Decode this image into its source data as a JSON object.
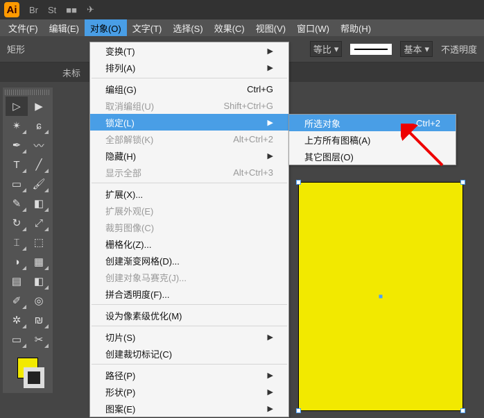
{
  "titlebar": {
    "logo": "Ai",
    "icons": [
      "Br",
      "St",
      "■■",
      "✈"
    ]
  },
  "menubar": {
    "items": [
      {
        "label": "文件(F)"
      },
      {
        "label": "编辑(E)"
      },
      {
        "label": "对象(O)",
        "open": true
      },
      {
        "label": "文字(T)"
      },
      {
        "label": "选择(S)"
      },
      {
        "label": "效果(C)"
      },
      {
        "label": "视图(V)"
      },
      {
        "label": "窗口(W)"
      },
      {
        "label": "帮助(H)"
      }
    ]
  },
  "optionsbar": {
    "shape": "矩形",
    "scale_label": "等比",
    "basic_label": "基本",
    "opacity_label": "不透明度"
  },
  "doctabs": {
    "tab1": "未标"
  },
  "object_menu": {
    "items": [
      {
        "label": "变换(T)",
        "arrow": true
      },
      {
        "label": "排列(A)",
        "arrow": true
      },
      {
        "sep": true
      },
      {
        "label": "编组(G)",
        "shortcut": "Ctrl+G"
      },
      {
        "label": "取消编组(U)",
        "shortcut": "Shift+Ctrl+G",
        "disabled": true
      },
      {
        "label": "锁定(L)",
        "arrow": true,
        "highlight": true
      },
      {
        "label": "全部解锁(K)",
        "shortcut": "Alt+Ctrl+2",
        "disabled": true
      },
      {
        "label": "隐藏(H)",
        "arrow": true
      },
      {
        "label": "显示全部",
        "shortcut": "Alt+Ctrl+3",
        "disabled": true
      },
      {
        "sep": true
      },
      {
        "label": "扩展(X)..."
      },
      {
        "label": "扩展外观(E)",
        "disabled": true
      },
      {
        "label": "裁剪图像(C)",
        "disabled": true
      },
      {
        "label": "栅格化(Z)..."
      },
      {
        "label": "创建渐变网格(D)..."
      },
      {
        "label": "创建对象马赛克(J)...",
        "disabled": true
      },
      {
        "label": "拼合透明度(F)..."
      },
      {
        "sep": true
      },
      {
        "label": "设为像素级优化(M)"
      },
      {
        "sep": true
      },
      {
        "label": "切片(S)",
        "arrow": true
      },
      {
        "label": "创建裁切标记(C)"
      },
      {
        "sep": true
      },
      {
        "label": "路径(P)",
        "arrow": true
      },
      {
        "label": "形状(P)",
        "arrow": true
      },
      {
        "label": "图案(E)",
        "arrow": true
      }
    ]
  },
  "lock_submenu": {
    "items": [
      {
        "label": "所选对象",
        "shortcut": "Ctrl+2",
        "highlight": true
      },
      {
        "label": "上方所有图稿(A)"
      },
      {
        "label": "其它图层(O)"
      }
    ]
  },
  "swatch": {
    "fill": "#f2e900"
  }
}
